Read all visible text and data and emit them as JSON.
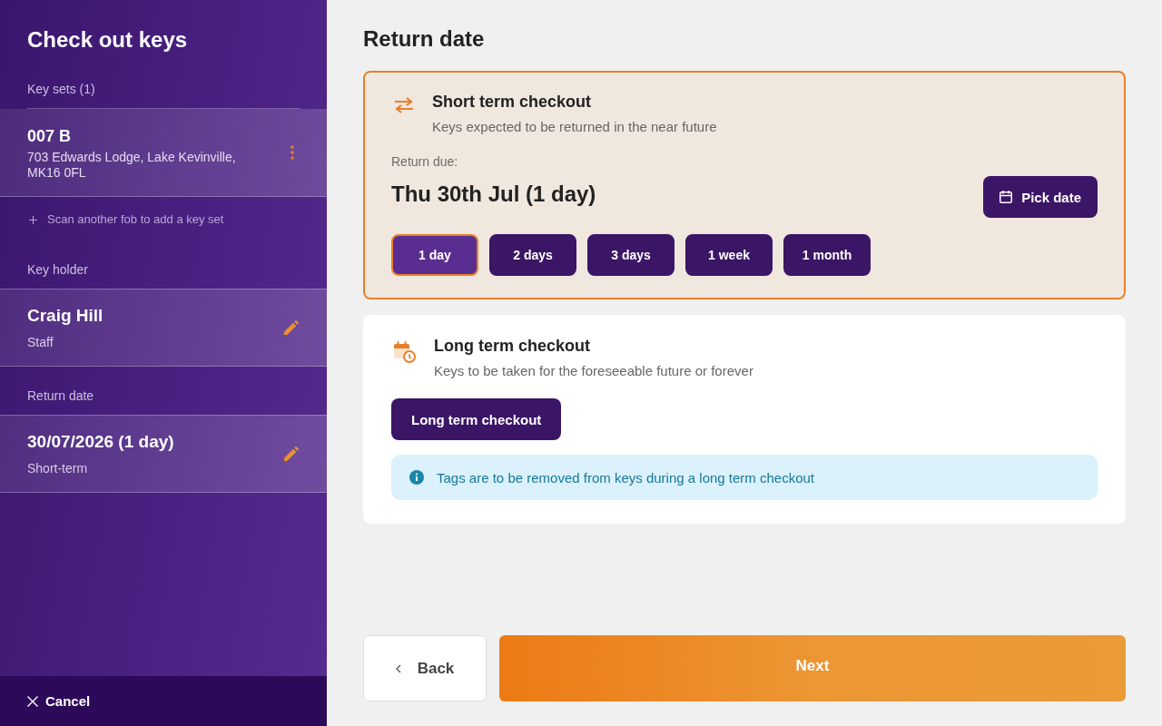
{
  "sidebar": {
    "title": "Check out keys",
    "key_sets": {
      "heading": "Key sets (1)",
      "items": [
        {
          "name": "007 B",
          "address": "703 Edwards Lodge, Lake Kevinville, MK16 0FL"
        }
      ],
      "scan_hint": "Scan another fob to add a key set"
    },
    "key_holder": {
      "heading": "Key holder",
      "name": "Craig Hill",
      "role": "Staff"
    },
    "return_date": {
      "heading": "Return date",
      "value": "30/07/2026 (1 day)",
      "type": "Short-term"
    },
    "cancel": "Cancel"
  },
  "main": {
    "title": "Return date",
    "options": [
      {
        "kind": "short",
        "selected": true,
        "title": "Short term checkout",
        "subtitle": "Keys expected to be returned in the near future",
        "due_label": "Return due:",
        "due_value": "Thu 30th Jul (1 day)",
        "pick_button": "Pick date",
        "durations": [
          {
            "label": "1 day",
            "selected": true
          },
          {
            "label": "2 days",
            "selected": false
          },
          {
            "label": "3 days",
            "selected": false
          },
          {
            "label": "1 week",
            "selected": false
          },
          {
            "label": "1 month",
            "selected": false
          }
        ]
      },
      {
        "kind": "long",
        "selected": false,
        "title": "Long term checkout",
        "subtitle": "Keys to be taken for the foreseeable future or forever",
        "button": "Long term checkout",
        "notice": "Tags are to be removed from keys during a long term checkout"
      }
    ],
    "footer": {
      "back": "Back",
      "next": "Next"
    }
  }
}
